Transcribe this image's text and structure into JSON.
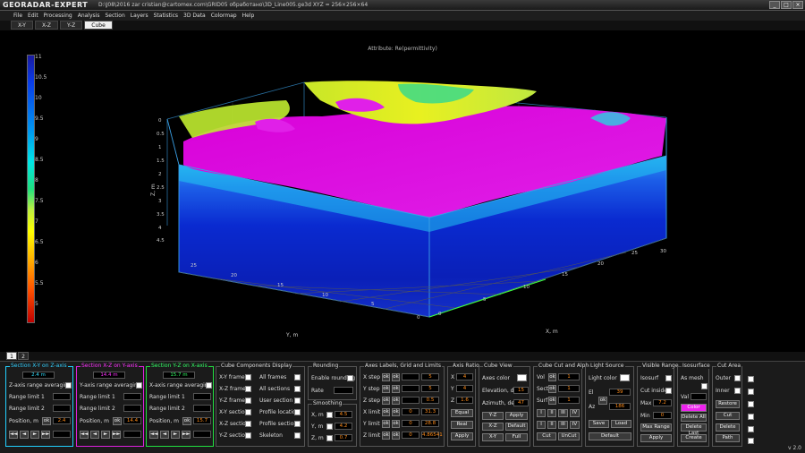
{
  "app": {
    "logo": "GEORADAR-EXPERT",
    "title_path": "D:\\J08\\2016 zar cristian@cartomex.com\\GRID05 обработано\\3D_Line005.ge3d    XYZ = 256×256×64",
    "window_buttons": [
      "_",
      "□",
      "×"
    ],
    "version": "v 2.0"
  },
  "menu": [
    "File",
    "Edit",
    "Processing",
    "Analysis",
    "Section",
    "Layers",
    "Statistics",
    "3D Data",
    "Colormap",
    "Help"
  ],
  "view_tabs": [
    "X-Y",
    "X-Z",
    "Y-Z",
    "Cube"
  ],
  "active_view_tab": "Cube",
  "viewport": {
    "attribute_title": "Attribute: Re(permittivity)",
    "colorbar_ticks": [
      "11",
      "10.5",
      "10",
      "9.5",
      "9",
      "8.5",
      "8",
      "7.5",
      "7",
      "6.5",
      "6",
      "5.5",
      "5"
    ],
    "z_label": "Z, m",
    "y_label": "Y, m",
    "x_label": "X, m",
    "z_ticks": [
      "0",
      "0.5",
      "1",
      "1.5",
      "2",
      "2.5",
      "3",
      "3.5",
      "4",
      "4.5"
    ],
    "y_ticks": [
      "25",
      "20",
      "15",
      "10",
      "5",
      "0"
    ],
    "x_ticks": [
      "0",
      "5",
      "10",
      "15",
      "20",
      "25",
      "30"
    ],
    "colors": {
      "magenta": "#e600e6",
      "blue": "#0a2cd8",
      "yellow": "#e6f01e",
      "cyan": "#00d0ff"
    }
  },
  "lower_tabs": [
    "1",
    "2"
  ],
  "sec_xy": {
    "title": "Section X-Y on Z-axis",
    "value": "2.4 m",
    "averaging": "Z-axis range averaging",
    "range1": "Range limit 1",
    "range2": "Range limit 2",
    "position": "Position, m",
    "pos_value": "2.4",
    "ok": "ok",
    "steps": [
      "◄◄",
      "◄",
      "►",
      "►►"
    ]
  },
  "sec_xz": {
    "title": "Section X-Z on Y-axis",
    "value": "14.4 m",
    "averaging": "Y-axis range averaging",
    "range1": "Range limit 1",
    "range2": "Range limit 2",
    "position": "Position, m",
    "pos_value": "14.4",
    "ok": "ok"
  },
  "sec_yz": {
    "title": "Section Y-Z on X-axis",
    "value": "15.7 m",
    "averaging": "X-axis range averaging",
    "range1": "Range limit 1",
    "range2": "Range limit 2",
    "position": "Position, m",
    "pos_value": "15.7",
    "ok": "ok"
  },
  "cube_display": {
    "title": "Cube Components Display",
    "left": [
      "X-Y frame",
      "X-Z frame",
      "Y-Z frame",
      "X-Y section",
      "X-Z section",
      "Y-Z section"
    ],
    "right": [
      "All frames",
      "All sections",
      "User section",
      "Profile location",
      "Profile section",
      "Skeleton"
    ]
  },
  "rounding": {
    "title": "Rounding",
    "enable": "Enable rounding",
    "rate": "Rate"
  },
  "smoothing": {
    "title": "Smoothing",
    "labels": [
      "X, m",
      "Y, m",
      "Z, m"
    ],
    "values": [
      "4.5",
      "4.2",
      "0.7"
    ]
  },
  "axes_labels": {
    "title": "Axes Labels, Grid and Limits",
    "rows": [
      {
        "label": "X step",
        "v1": "",
        "v2": "5"
      },
      {
        "label": "Y step",
        "v1": "",
        "v2": "5"
      },
      {
        "label": "Z step",
        "v1": "",
        "v2": "0.5"
      },
      {
        "label": "X limit",
        "v1": "0",
        "v2": "31.3"
      },
      {
        "label": "Y limit",
        "v1": "0",
        "v2": "28.8"
      },
      {
        "label": "Z limit",
        "v1": "0",
        "v2": "4.86541"
      }
    ],
    "ok": "ok"
  },
  "axis_ratio": {
    "title": "Axis Ratio",
    "labels": [
      "X",
      "Y",
      "Z"
    ],
    "values": [
      "4",
      "4",
      "1.6"
    ],
    "buttons": [
      "Equal",
      "Real",
      "Apply"
    ]
  },
  "cube_view": {
    "title": "Cube View",
    "axes_color": "Axes color",
    "elevation": "Elevation, deg",
    "elev_value": "15",
    "azimuth": "Azimuth, deg",
    "az_value": "47",
    "buttons": [
      [
        "Y-Z",
        "Apply"
      ],
      [
        "X-Z",
        "Default"
      ],
      [
        "X-Y",
        "Full"
      ]
    ]
  },
  "cut_alpha": {
    "title": "Cube Cut and Alpha",
    "labels": [
      "Vol",
      "Sect",
      "Surf"
    ],
    "values": [
      "1",
      "1",
      "1"
    ],
    "roman": [
      "I",
      "II",
      "III",
      "IV"
    ],
    "buttons": [
      "Cut",
      "UnCut"
    ],
    "ok": "ok"
  },
  "light": {
    "title": "Light Source",
    "color": "Light color",
    "labels": [
      "El",
      "Az"
    ],
    "values": [
      "39",
      "186"
    ],
    "buttons": [
      "Save",
      "Load",
      "Default"
    ],
    "ok": "ok"
  },
  "visible_range": {
    "title": "Visible Range",
    "isosurf": "Isosurf",
    "cut_inside": "Cut inside",
    "max": "Max",
    "max_value": "7.2",
    "min": "Min",
    "min_value": "0",
    "buttons": [
      "Max Range",
      "Apply"
    ]
  },
  "isosurface": {
    "title": "Isosurface",
    "as_mesh": "As mesh",
    "val": "Val",
    "buttons": [
      "Color",
      "Delete All",
      "Delete Last",
      "Create"
    ]
  },
  "cut_area": {
    "title": "Cut Area",
    "outer": "Outer",
    "inner": "Inner",
    "buttons": [
      "Restore",
      "Cut",
      "Delete",
      "Path"
    ]
  }
}
